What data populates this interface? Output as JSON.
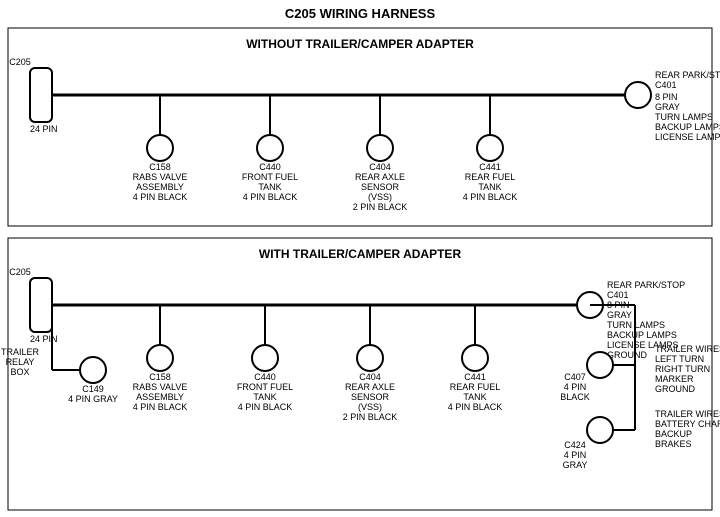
{
  "title": "C205 WIRING HARNESS",
  "section1": {
    "label": "WITHOUT TRAILER/CAMPER ADAPTER",
    "left_connector": {
      "id": "C205",
      "pins": "24 PIN"
    },
    "right_connector": {
      "id": "C401",
      "pins": "8 PIN",
      "color": "GRAY",
      "desc": "REAR PARK/STOP\nTURN LAMPS\nBACKUP LAMPS\nLICENSE LAMPS"
    },
    "connectors": [
      {
        "id": "C158",
        "desc": "RABS VALVE\nASSEMBLY\n4 PIN BLACK"
      },
      {
        "id": "C440",
        "desc": "FRONT FUEL\nTANK\n4 PIN BLACK"
      },
      {
        "id": "C404",
        "desc": "REAR AXLE\nSENSOR\n(VSS)\n2 PIN BLACK"
      },
      {
        "id": "C441",
        "desc": "REAR FUEL\nTANK\n4 PIN BLACK"
      }
    ]
  },
  "section2": {
    "label": "WITH TRAILER/CAMPER ADAPTER",
    "left_connector": {
      "id": "C205",
      "pins": "24 PIN"
    },
    "right_connector": {
      "id": "C401",
      "pins": "8 PIN",
      "color": "GRAY",
      "desc": "REAR PARK/STOP\nTURN LAMPS\nBACKUP LAMPS\nLICENSE LAMPS\nGROUND"
    },
    "connectors": [
      {
        "id": "C158",
        "desc": "RABS VALVE\nASSEMBLY\n4 PIN BLACK"
      },
      {
        "id": "C440",
        "desc": "FRONT FUEL\nTANK\n4 PIN BLACK"
      },
      {
        "id": "C404",
        "desc": "REAR AXLE\nSENSOR\n(VSS)\n2 PIN BLACK"
      },
      {
        "id": "C441",
        "desc": "REAR FUEL\nTANK\n4 PIN BLACK"
      }
    ],
    "extra_left": {
      "id": "C149",
      "pins": "4 PIN GRAY",
      "label": "TRAILER\nRELAY\nBOX"
    },
    "extra_right1": {
      "id": "C407",
      "pins": "4 PIN\nBLACK",
      "desc": "TRAILER WIRES\nLEFT TURN\nRIGHT TURN\nMARKER\nGROUND"
    },
    "extra_right2": {
      "id": "C424",
      "pins": "4 PIN\nGRAY",
      "desc": "TRAILER WIRES\nBATTERY CHARGE\nBACKUP\nBRAKES"
    }
  }
}
